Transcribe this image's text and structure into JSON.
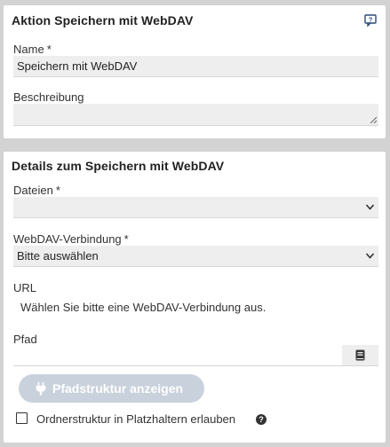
{
  "action_panel": {
    "title": "Aktion Speichern mit WebDAV",
    "name_label": "Name",
    "required_mark": "*",
    "name_value": "Speichern mit WebDAV",
    "description_label": "Beschreibung",
    "description_value": ""
  },
  "details_panel": {
    "title": "Details zum Speichern mit WebDAV",
    "files_label": "Dateien",
    "files_value": "",
    "connection_label": "WebDAV-Verbindung",
    "connection_value": "Bitte auswählen",
    "url_label": "URL",
    "url_hint": "Wählen Sie bitte eine WebDAV-Verbindung aus.",
    "path_label": "Pfad",
    "path_value": "",
    "show_structure_button": "Pfadstruktur anzeigen",
    "folder_structure_checkbox": "Ordnerstruktur in Platzhaltern erlauben",
    "folder_structure_checked": false
  },
  "icons": {
    "help": "help-comment-icon",
    "chevron": "chevron-down-icon",
    "browse": "book-icon",
    "plug": "plug-icon",
    "info": "question-circle-icon"
  },
  "colors": {
    "background": "#d3d3d3",
    "panel": "#ffffff",
    "field": "#eeeeee",
    "button_disabled": "#c9d1dc",
    "help_icon": "#2b4a7a"
  }
}
